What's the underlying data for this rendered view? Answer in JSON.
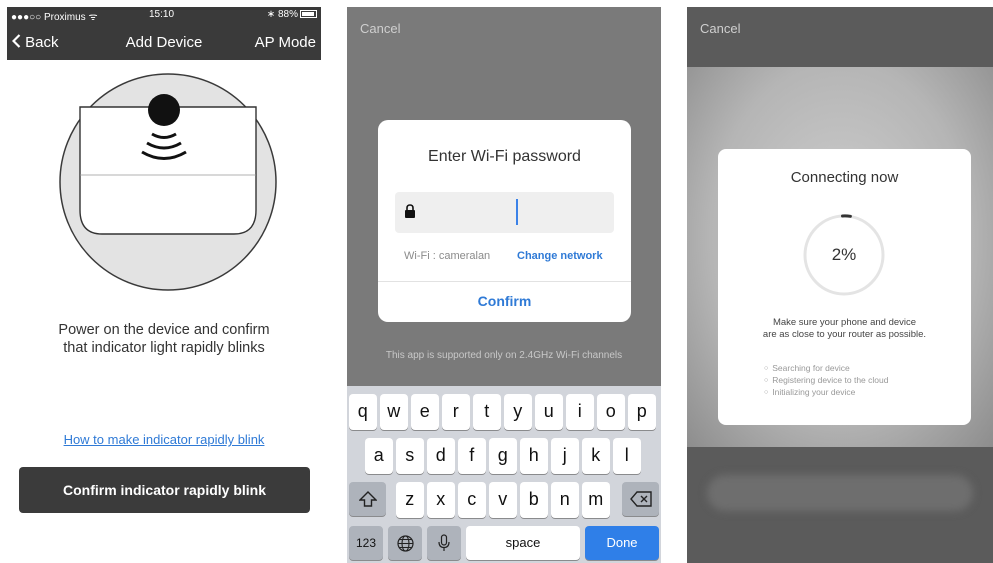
{
  "screen1": {
    "status": {
      "carrier": "●●●○○ Proximus",
      "wifi": "ᯤ",
      "time": "15:10",
      "bluetooth": "∗",
      "battery": "88%"
    },
    "nav": {
      "back_icon": "chevron-left",
      "back": "Back",
      "title": "Add Device",
      "right": "AP Mode"
    },
    "instruction_line1": "Power on the device and confirm",
    "instruction_line2": "that indicator light rapidly blinks",
    "help_link": "How to make indicator rapidly blink",
    "confirm_button": "Confirm indicator rapidly blink"
  },
  "screen2": {
    "cancel": "Cancel",
    "dialog": {
      "title": "Enter Wi-Fi password",
      "password_value": "",
      "wifi_label": "Wi-Fi : cameralan",
      "change_network": "Change network",
      "confirm": "Confirm"
    },
    "support_note": "This app is supported only on 2.4GHz Wi-Fi channels",
    "keyboard": {
      "row1": [
        "q",
        "w",
        "e",
        "r",
        "t",
        "y",
        "u",
        "i",
        "o",
        "p"
      ],
      "row2": [
        "a",
        "s",
        "d",
        "f",
        "g",
        "h",
        "j",
        "k",
        "l"
      ],
      "row3": [
        "z",
        "x",
        "c",
        "v",
        "b",
        "n",
        "m"
      ],
      "shift_icon": "shift-icon",
      "delete_icon": "delete-icon",
      "numbers": "123",
      "globe_icon": "globe-icon",
      "mic_icon": "mic-icon",
      "space": "space",
      "done": "Done"
    }
  },
  "screen3": {
    "cancel": "Cancel",
    "title": "Connecting now",
    "progress": "2%",
    "progress_fraction": 0.02,
    "note_line1": "Make sure your phone and device",
    "note_line2": "are as close to your router as possible.",
    "steps": [
      "Searching for device",
      "Registering device to the cloud",
      "Initializing your device"
    ]
  },
  "colors": {
    "nav_bg": "#3a3a3a",
    "link_blue": "#2f7ad6",
    "done_blue": "#2f7fe8",
    "button_dark": "#3b3b3b",
    "keyboard_bg": "#d2d5db"
  }
}
